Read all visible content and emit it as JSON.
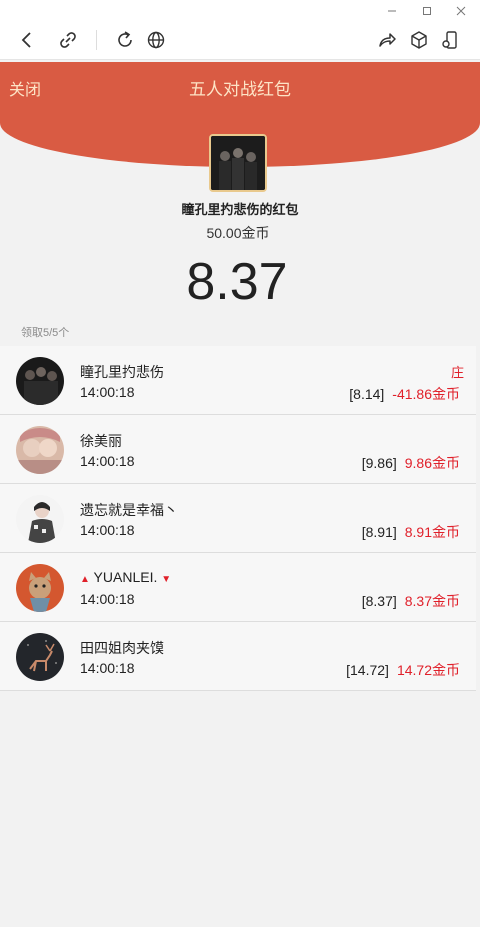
{
  "window": {
    "minimize": "—",
    "maximize": "▢",
    "close": "✕"
  },
  "header": {
    "close_label": "关闭",
    "title": "五人对战红包"
  },
  "packet": {
    "sender_name": "瞳孔里扚悲伤的红包",
    "amount": "50.00金币",
    "my_amount": "8.37"
  },
  "claimed_count": "领取5/5个",
  "rows": [
    {
      "name": "瞳孔里扚悲伤",
      "time": "14:00:18",
      "value": "[8.14]",
      "gold": "-41.86金币",
      "tag": "庄"
    },
    {
      "name": "徐美丽",
      "time": "14:00:18",
      "value": "[9.86]",
      "gold": "9.86金币",
      "tag": ""
    },
    {
      "name": "遗忘就是幸福丶",
      "time": "14:00:18",
      "value": "[8.91]",
      "gold": "8.91金币",
      "tag": ""
    },
    {
      "name": "YUANLEI.",
      "time": "14:00:18",
      "value": "[8.37]",
      "gold": "8.37金币",
      "tag": "",
      "up": "▲",
      "down": "▼"
    },
    {
      "name": "田四姐肉夹馍",
      "time": "14:00:18",
      "value": "[14.72]",
      "gold": "14.72金币",
      "tag": ""
    }
  ],
  "colors": {
    "header_red": "#d95b43",
    "header_text": "#fde4c6",
    "gold_red": "#e0202a"
  }
}
